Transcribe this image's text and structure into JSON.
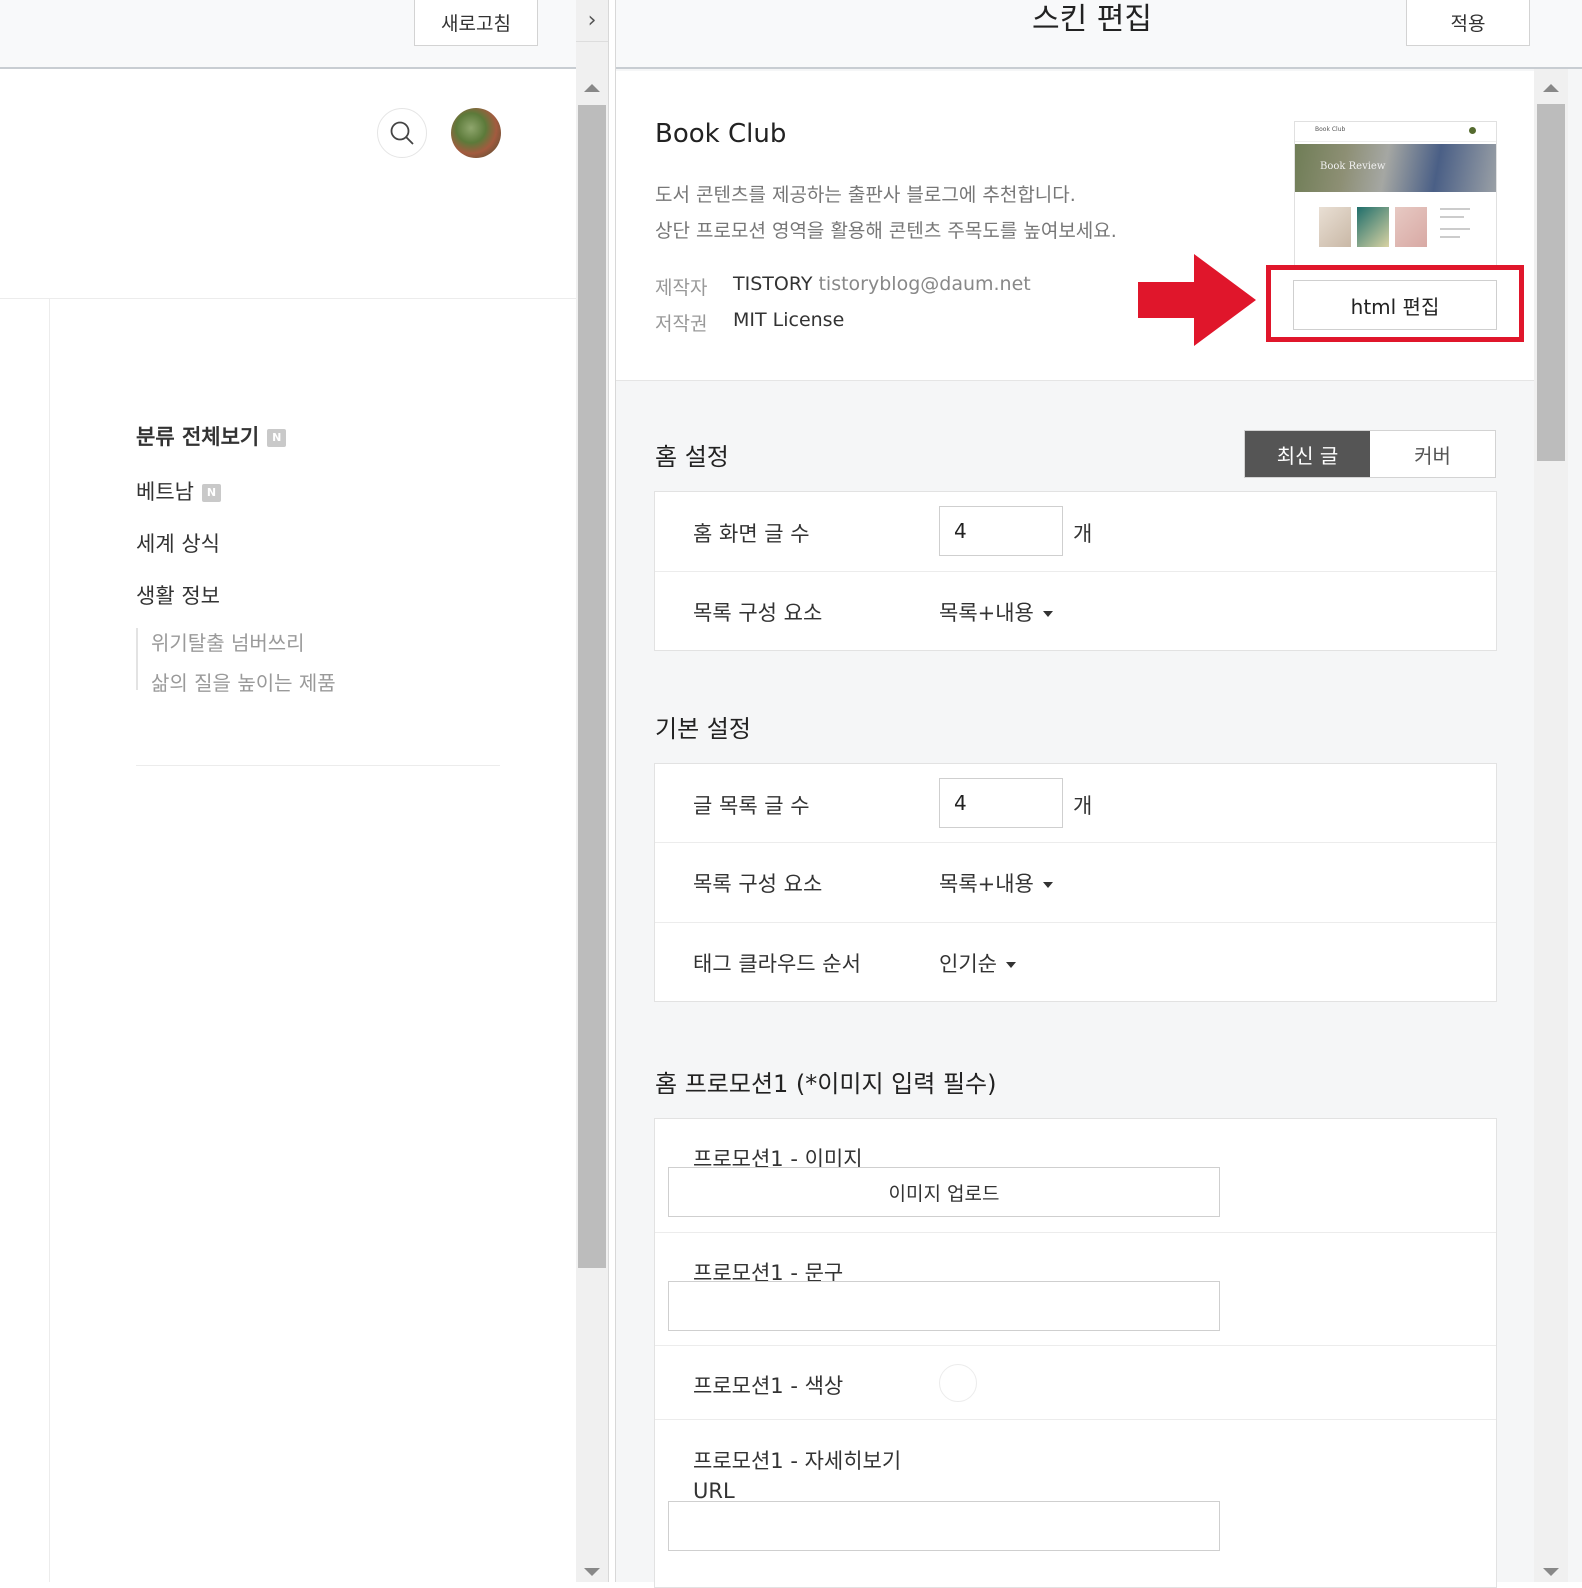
{
  "left": {
    "refresh_label": "새로고침",
    "collapse_glyph": "›",
    "categories": [
      {
        "label": "분류 전체보기",
        "badge": "N"
      },
      {
        "label": "베트남",
        "badge": "N"
      },
      {
        "label": "세계 상식"
      },
      {
        "label": "생활 정보"
      }
    ],
    "subcategories": [
      "위기탈출 넘버쓰리",
      "삶의 질을 높이는 제품"
    ]
  },
  "editor": {
    "title": "스킨 편집",
    "apply_label": "적용",
    "skin": {
      "name": "Book Club",
      "desc_line1": "도서 콘텐츠를 제공하는 출판사 블로그에 추천합니다.",
      "desc_line2": "상단 프로모션 영역을 활용해 콘텐츠 주목도를 높여보세요.",
      "author_label": "제작자",
      "author_name": "TISTORY",
      "author_email": "tistoryblog@daum.net",
      "license_label": "저작권",
      "license_value": "MIT License",
      "thumb_header": "Book Club",
      "thumb_hero": "Book Review",
      "html_edit_label": "html 편집"
    },
    "home": {
      "title": "홈 설정",
      "toggle_on": "최신 글",
      "toggle_off": "커버",
      "count_label": "홈 화면 글 수",
      "count_value": "4",
      "unit": "개",
      "list_label": "목록 구성 요소",
      "list_value": "목록+내용"
    },
    "basic": {
      "title": "기본 설정",
      "count_label": "글 목록 글 수",
      "count_value": "4",
      "unit": "개",
      "list_label": "목록 구성 요소",
      "list_value": "목록+내용",
      "tag_label": "태그 클라우드 순서",
      "tag_value": "인기순"
    },
    "promo": {
      "title": "홈 프로모션1 (*이미지 입력 필수)",
      "image_label": "프로모션1 - 이미지",
      "upload_label": "이미지 업로드",
      "text_label": "프로모션1 - 문구",
      "color_label": "프로모션1 - 색상",
      "url_label_line1": "프로모션1 - 자세히보기",
      "url_label_line2": "URL"
    }
  },
  "colors": {
    "accent_red": "#e0162b",
    "toggle_active": "#555555"
  }
}
